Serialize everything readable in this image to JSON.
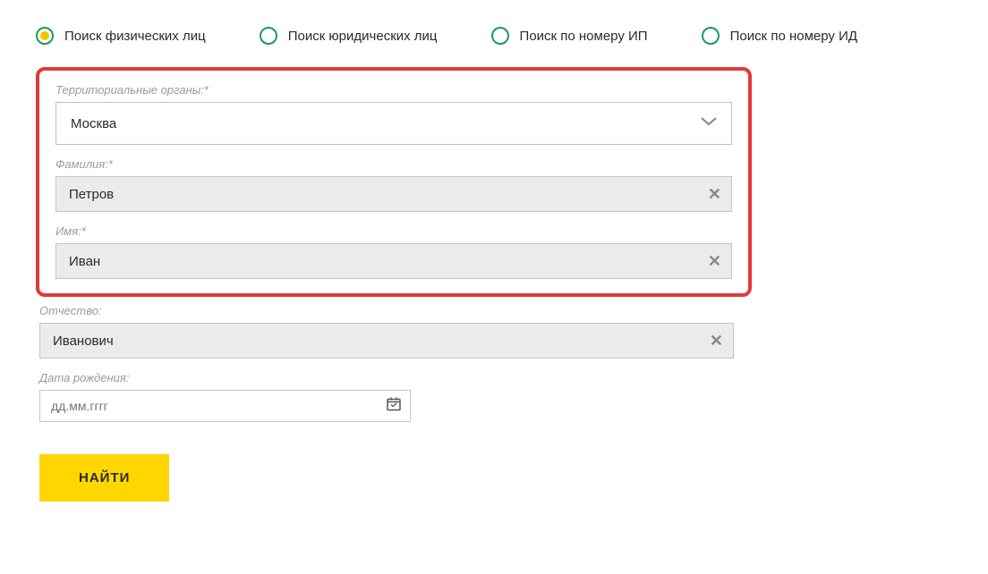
{
  "radios": {
    "individuals": "Поиск физических лиц",
    "legal": "Поиск юридических лиц",
    "ip": "Поиск по номеру ИП",
    "id": "Поиск по номеру ИД"
  },
  "labels": {
    "territory": "Территориальные органы:*",
    "lastname": "Фамилия:*",
    "firstname": "Имя:*",
    "patronymic": "Отчество:",
    "birthdate": "Дата рождения:"
  },
  "values": {
    "territory": "Москва",
    "lastname": "Петров",
    "firstname": "Иван",
    "patronymic": "Иванович",
    "birthdate_placeholder": "дд.мм.гггг"
  },
  "buttons": {
    "submit": "НАЙТИ"
  }
}
